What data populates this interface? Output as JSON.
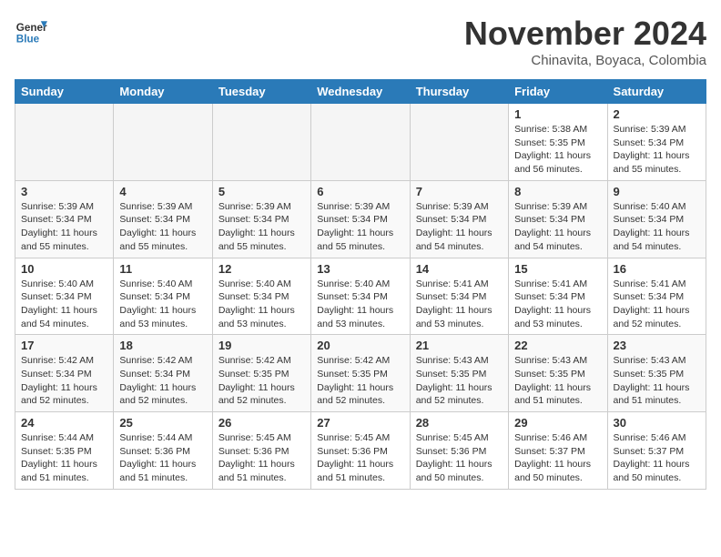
{
  "header": {
    "logo_line1": "General",
    "logo_line2": "Blue",
    "month_title": "November 2024",
    "location": "Chinavita, Boyaca, Colombia"
  },
  "weekdays": [
    "Sunday",
    "Monday",
    "Tuesday",
    "Wednesday",
    "Thursday",
    "Friday",
    "Saturday"
  ],
  "weeks": [
    [
      {
        "day": "",
        "info": ""
      },
      {
        "day": "",
        "info": ""
      },
      {
        "day": "",
        "info": ""
      },
      {
        "day": "",
        "info": ""
      },
      {
        "day": "",
        "info": ""
      },
      {
        "day": "1",
        "info": "Sunrise: 5:38 AM\nSunset: 5:35 PM\nDaylight: 11 hours\nand 56 minutes."
      },
      {
        "day": "2",
        "info": "Sunrise: 5:39 AM\nSunset: 5:34 PM\nDaylight: 11 hours\nand 55 minutes."
      }
    ],
    [
      {
        "day": "3",
        "info": "Sunrise: 5:39 AM\nSunset: 5:34 PM\nDaylight: 11 hours\nand 55 minutes."
      },
      {
        "day": "4",
        "info": "Sunrise: 5:39 AM\nSunset: 5:34 PM\nDaylight: 11 hours\nand 55 minutes."
      },
      {
        "day": "5",
        "info": "Sunrise: 5:39 AM\nSunset: 5:34 PM\nDaylight: 11 hours\nand 55 minutes."
      },
      {
        "day": "6",
        "info": "Sunrise: 5:39 AM\nSunset: 5:34 PM\nDaylight: 11 hours\nand 55 minutes."
      },
      {
        "day": "7",
        "info": "Sunrise: 5:39 AM\nSunset: 5:34 PM\nDaylight: 11 hours\nand 54 minutes."
      },
      {
        "day": "8",
        "info": "Sunrise: 5:39 AM\nSunset: 5:34 PM\nDaylight: 11 hours\nand 54 minutes."
      },
      {
        "day": "9",
        "info": "Sunrise: 5:40 AM\nSunset: 5:34 PM\nDaylight: 11 hours\nand 54 minutes."
      }
    ],
    [
      {
        "day": "10",
        "info": "Sunrise: 5:40 AM\nSunset: 5:34 PM\nDaylight: 11 hours\nand 54 minutes."
      },
      {
        "day": "11",
        "info": "Sunrise: 5:40 AM\nSunset: 5:34 PM\nDaylight: 11 hours\nand 53 minutes."
      },
      {
        "day": "12",
        "info": "Sunrise: 5:40 AM\nSunset: 5:34 PM\nDaylight: 11 hours\nand 53 minutes."
      },
      {
        "day": "13",
        "info": "Sunrise: 5:40 AM\nSunset: 5:34 PM\nDaylight: 11 hours\nand 53 minutes."
      },
      {
        "day": "14",
        "info": "Sunrise: 5:41 AM\nSunset: 5:34 PM\nDaylight: 11 hours\nand 53 minutes."
      },
      {
        "day": "15",
        "info": "Sunrise: 5:41 AM\nSunset: 5:34 PM\nDaylight: 11 hours\nand 53 minutes."
      },
      {
        "day": "16",
        "info": "Sunrise: 5:41 AM\nSunset: 5:34 PM\nDaylight: 11 hours\nand 52 minutes."
      }
    ],
    [
      {
        "day": "17",
        "info": "Sunrise: 5:42 AM\nSunset: 5:34 PM\nDaylight: 11 hours\nand 52 minutes."
      },
      {
        "day": "18",
        "info": "Sunrise: 5:42 AM\nSunset: 5:34 PM\nDaylight: 11 hours\nand 52 minutes."
      },
      {
        "day": "19",
        "info": "Sunrise: 5:42 AM\nSunset: 5:35 PM\nDaylight: 11 hours\nand 52 minutes."
      },
      {
        "day": "20",
        "info": "Sunrise: 5:42 AM\nSunset: 5:35 PM\nDaylight: 11 hours\nand 52 minutes."
      },
      {
        "day": "21",
        "info": "Sunrise: 5:43 AM\nSunset: 5:35 PM\nDaylight: 11 hours\nand 52 minutes."
      },
      {
        "day": "22",
        "info": "Sunrise: 5:43 AM\nSunset: 5:35 PM\nDaylight: 11 hours\nand 51 minutes."
      },
      {
        "day": "23",
        "info": "Sunrise: 5:43 AM\nSunset: 5:35 PM\nDaylight: 11 hours\nand 51 minutes."
      }
    ],
    [
      {
        "day": "24",
        "info": "Sunrise: 5:44 AM\nSunset: 5:35 PM\nDaylight: 11 hours\nand 51 minutes."
      },
      {
        "day": "25",
        "info": "Sunrise: 5:44 AM\nSunset: 5:36 PM\nDaylight: 11 hours\nand 51 minutes."
      },
      {
        "day": "26",
        "info": "Sunrise: 5:45 AM\nSunset: 5:36 PM\nDaylight: 11 hours\nand 51 minutes."
      },
      {
        "day": "27",
        "info": "Sunrise: 5:45 AM\nSunset: 5:36 PM\nDaylight: 11 hours\nand 51 minutes."
      },
      {
        "day": "28",
        "info": "Sunrise: 5:45 AM\nSunset: 5:36 PM\nDaylight: 11 hours\nand 50 minutes."
      },
      {
        "day": "29",
        "info": "Sunrise: 5:46 AM\nSunset: 5:37 PM\nDaylight: 11 hours\nand 50 minutes."
      },
      {
        "day": "30",
        "info": "Sunrise: 5:46 AM\nSunset: 5:37 PM\nDaylight: 11 hours\nand 50 minutes."
      }
    ]
  ]
}
